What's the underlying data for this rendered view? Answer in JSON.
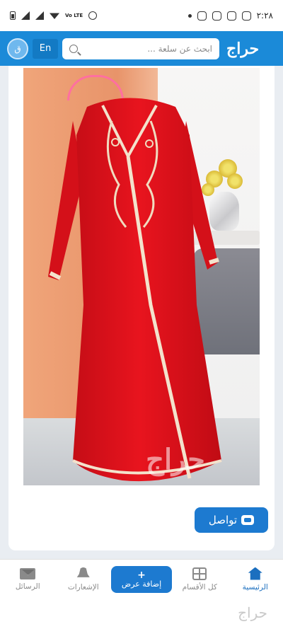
{
  "status_bar": {
    "time": "٢:٢٨",
    "carrier": "Vo LTE"
  },
  "header": {
    "avatar_letter": "ق",
    "lang_label": "En",
    "search_placeholder": "ابحث عن سلعة ...",
    "brand": "حراج",
    "bg_color": "#1b8ad8"
  },
  "listing": {
    "photo_watermark": "حراج",
    "contact_label": "تواصل"
  },
  "bottom_nav": {
    "home_label": "الرئيسية",
    "categories_label": "كل الأقسام",
    "add_offer_plus": "+",
    "add_offer_label": "إضافة عرض",
    "notifications_label": "الإشعارات",
    "messages_label": "الرسائل"
  },
  "footer": {
    "watermark": "حراج"
  },
  "colors": {
    "accent": "#1d7ad0",
    "dress_red": "#e3121c"
  }
}
